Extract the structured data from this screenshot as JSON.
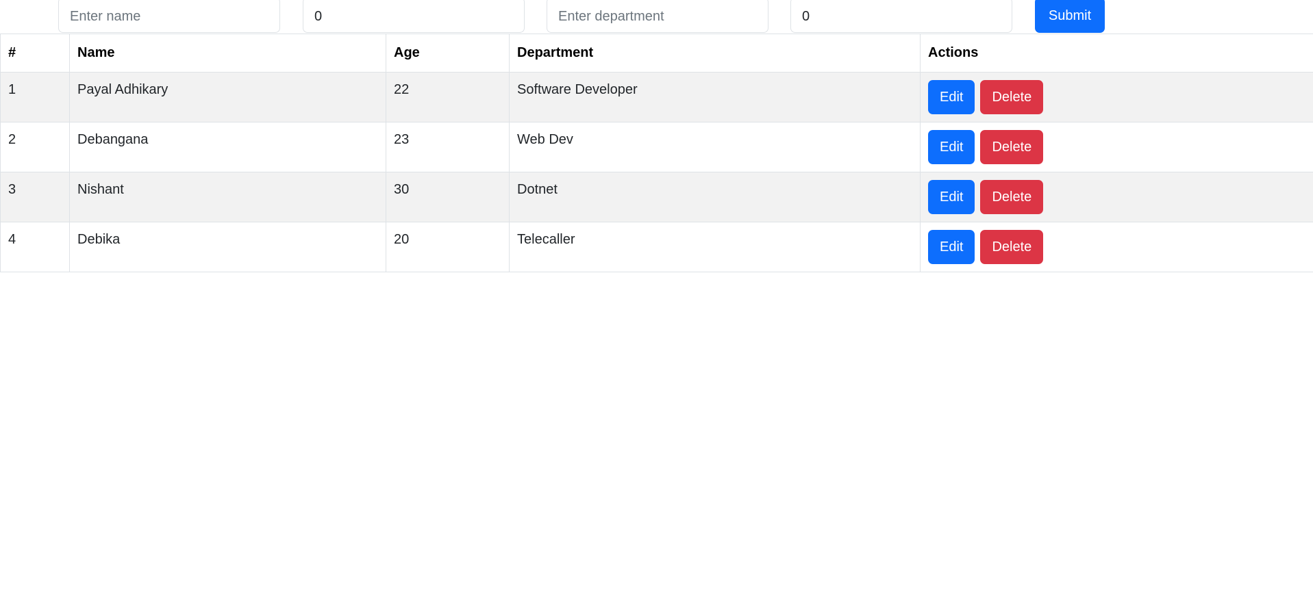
{
  "form": {
    "name_placeholder": "Enter name",
    "name_value": "",
    "age_value": "0",
    "department_placeholder": "Enter department",
    "department_value": "",
    "extra_value": "0",
    "submit_label": "Submit"
  },
  "table": {
    "headers": [
      "#",
      "Name",
      "Age",
      "Department",
      "Actions"
    ],
    "rows": [
      {
        "id": "1",
        "name": "Payal Adhikary",
        "age": "22",
        "department": "Software Developer"
      },
      {
        "id": "2",
        "name": "Debangana",
        "age": "23",
        "department": "Web Dev"
      },
      {
        "id": "3",
        "name": "Nishant",
        "age": "30",
        "department": "Dotnet"
      },
      {
        "id": "4",
        "name": "Debika",
        "age": "20",
        "department": "Telecaller"
      }
    ],
    "edit_label": "Edit",
    "delete_label": "Delete"
  },
  "colors": {
    "primary": "#0d6efd",
    "danger": "#dc3545",
    "striped_row": "#f2f2f2",
    "border": "#dee2e6"
  }
}
